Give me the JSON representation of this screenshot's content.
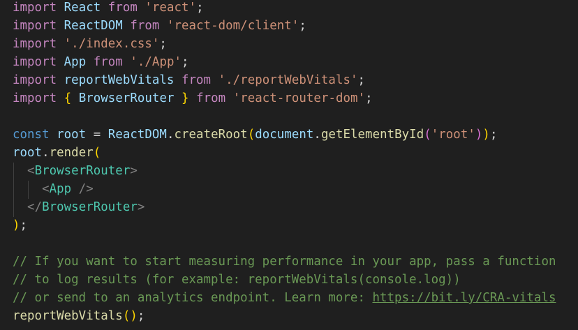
{
  "colors": {
    "background": "#1f1f1f",
    "keyword": "#c586c0",
    "storage": "#569cd6",
    "variable": "#9cdcfe",
    "function": "#dcdcaa",
    "string": "#ce9178",
    "punctuation": "#d4d4d4",
    "brace": "#ffd700",
    "paren2": "#da70d6",
    "paren3": "#179fff",
    "tag": "#4ec9b0",
    "tag_bracket": "#808080",
    "comment": "#6a9955",
    "indent_guide": "#404040"
  },
  "lines": [
    [
      {
        "t": "import",
        "c": "keyword"
      },
      {
        "t": " ",
        "c": "punctuation"
      },
      {
        "t": "React",
        "c": "variable"
      },
      {
        "t": " ",
        "c": "punctuation"
      },
      {
        "t": "from",
        "c": "keyword"
      },
      {
        "t": " ",
        "c": "punctuation"
      },
      {
        "t": "'react'",
        "c": "string"
      },
      {
        "t": ";",
        "c": "punctuation"
      }
    ],
    [
      {
        "t": "import",
        "c": "keyword"
      },
      {
        "t": " ",
        "c": "punctuation"
      },
      {
        "t": "ReactDOM",
        "c": "variable"
      },
      {
        "t": " ",
        "c": "punctuation"
      },
      {
        "t": "from",
        "c": "keyword"
      },
      {
        "t": " ",
        "c": "punctuation"
      },
      {
        "t": "'react-dom/client'",
        "c": "string"
      },
      {
        "t": ";",
        "c": "punctuation"
      }
    ],
    [
      {
        "t": "import",
        "c": "keyword"
      },
      {
        "t": " ",
        "c": "punctuation"
      },
      {
        "t": "'./index.css'",
        "c": "string"
      },
      {
        "t": ";",
        "c": "punctuation"
      }
    ],
    [
      {
        "t": "import",
        "c": "keyword"
      },
      {
        "t": " ",
        "c": "punctuation"
      },
      {
        "t": "App",
        "c": "variable"
      },
      {
        "t": " ",
        "c": "punctuation"
      },
      {
        "t": "from",
        "c": "keyword"
      },
      {
        "t": " ",
        "c": "punctuation"
      },
      {
        "t": "'./App'",
        "c": "string"
      },
      {
        "t": ";",
        "c": "punctuation"
      }
    ],
    [
      {
        "t": "import",
        "c": "keyword"
      },
      {
        "t": " ",
        "c": "punctuation"
      },
      {
        "t": "reportWebVitals",
        "c": "variable"
      },
      {
        "t": " ",
        "c": "punctuation"
      },
      {
        "t": "from",
        "c": "keyword"
      },
      {
        "t": " ",
        "c": "punctuation"
      },
      {
        "t": "'./reportWebVitals'",
        "c": "string"
      },
      {
        "t": ";",
        "c": "punctuation"
      }
    ],
    [
      {
        "t": "import",
        "c": "keyword"
      },
      {
        "t": " ",
        "c": "punctuation"
      },
      {
        "t": "{",
        "c": "brace"
      },
      {
        "t": " ",
        "c": "punctuation"
      },
      {
        "t": "BrowserRouter",
        "c": "variable"
      },
      {
        "t": " ",
        "c": "punctuation"
      },
      {
        "t": "}",
        "c": "brace"
      },
      {
        "t": " ",
        "c": "punctuation"
      },
      {
        "t": "from",
        "c": "keyword"
      },
      {
        "t": " ",
        "c": "punctuation"
      },
      {
        "t": "'react-router-dom'",
        "c": "string"
      },
      {
        "t": ";",
        "c": "punctuation"
      }
    ],
    [],
    [
      {
        "t": "const",
        "c": "storage"
      },
      {
        "t": " ",
        "c": "punctuation"
      },
      {
        "t": "root",
        "c": "variable"
      },
      {
        "t": " = ",
        "c": "punctuation"
      },
      {
        "t": "ReactDOM",
        "c": "variable"
      },
      {
        "t": ".",
        "c": "punctuation"
      },
      {
        "t": "createRoot",
        "c": "function"
      },
      {
        "t": "(",
        "c": "brace"
      },
      {
        "t": "document",
        "c": "variable"
      },
      {
        "t": ".",
        "c": "punctuation"
      },
      {
        "t": "getElementById",
        "c": "function"
      },
      {
        "t": "(",
        "c": "paren2"
      },
      {
        "t": "'root'",
        "c": "string"
      },
      {
        "t": ")",
        "c": "paren2"
      },
      {
        "t": ")",
        "c": "brace"
      },
      {
        "t": ";",
        "c": "punctuation"
      }
    ],
    [
      {
        "t": "root",
        "c": "variable"
      },
      {
        "t": ".",
        "c": "punctuation"
      },
      {
        "t": "render",
        "c": "function"
      },
      {
        "t": "(",
        "c": "brace"
      }
    ],
    [
      {
        "t": "  ",
        "c": "punctuation"
      },
      {
        "t": "<",
        "c": "tag_bracket"
      },
      {
        "t": "BrowserRouter",
        "c": "tag"
      },
      {
        "t": ">",
        "c": "tag_bracket"
      }
    ],
    [
      {
        "t": "    ",
        "c": "punctuation"
      },
      {
        "t": "<",
        "c": "tag_bracket"
      },
      {
        "t": "App",
        "c": "tag"
      },
      {
        "t": " />",
        "c": "tag_bracket"
      }
    ],
    [
      {
        "t": "  ",
        "c": "punctuation"
      },
      {
        "t": "</",
        "c": "tag_bracket"
      },
      {
        "t": "BrowserRouter",
        "c": "tag"
      },
      {
        "t": ">",
        "c": "tag_bracket"
      }
    ],
    [
      {
        "t": ")",
        "c": "brace"
      },
      {
        "t": ";",
        "c": "punctuation"
      }
    ],
    [],
    [
      {
        "t": "// If you want to start measuring performance in your app, pass a function",
        "c": "comment"
      }
    ],
    [
      {
        "t": "// to log results (for example: reportWebVitals(console.log))",
        "c": "comment"
      }
    ],
    [
      {
        "t": "// or send to an analytics endpoint. Learn more: ",
        "c": "comment"
      },
      {
        "t": "https://bit.ly/CRA-vitals",
        "c": "comment",
        "link": true
      }
    ],
    [
      {
        "t": "reportWebVitals",
        "c": "function"
      },
      {
        "t": "(",
        "c": "brace"
      },
      {
        "t": ")",
        "c": "brace"
      },
      {
        "t": ";",
        "c": "punctuation"
      }
    ]
  ]
}
